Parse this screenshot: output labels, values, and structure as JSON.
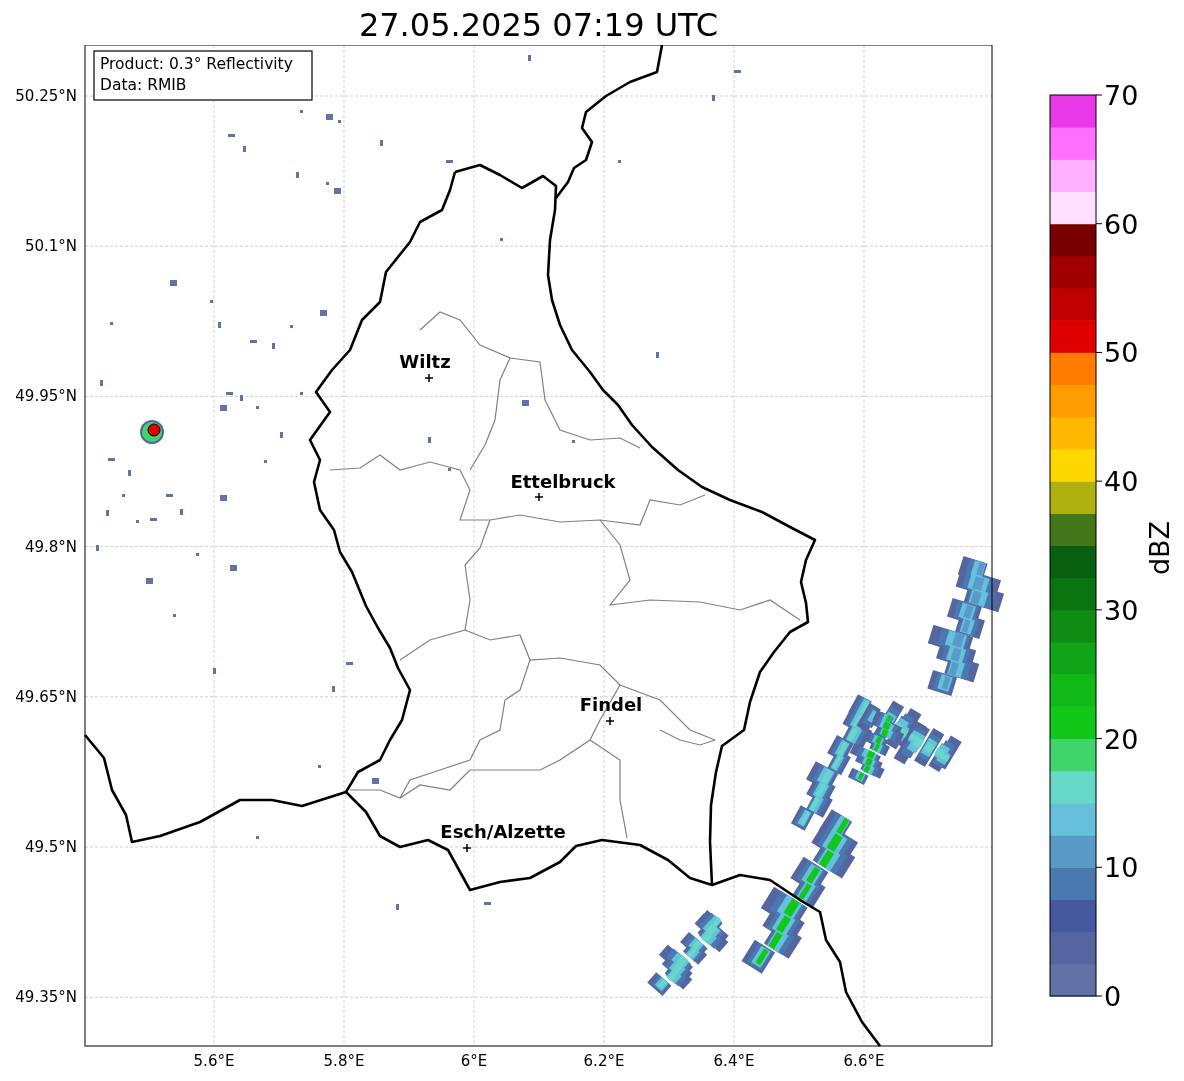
{
  "title": "27.05.2025 07:19 UTC",
  "info_box": {
    "lines": [
      "Product: 0.3° Reflectivity",
      "Data: RMIB"
    ]
  },
  "map": {
    "lat_ticks": [
      "50.25°N",
      "50.1°N",
      "49.95°N",
      "49.8°N",
      "49.65°N",
      "49.5°N",
      "49.35°N"
    ],
    "lon_ticks": [
      "5.6°E",
      "5.8°E",
      "6°E",
      "6.2°E",
      "6.4°E",
      "6.6°E"
    ],
    "cities": [
      {
        "name": "Wiltz"
      },
      {
        "name": "Ettelbruck"
      },
      {
        "name": "Findel"
      },
      {
        "name": "Esch/Alzette"
      }
    ]
  },
  "colorbar": {
    "label": "dBZ",
    "ticks": [
      "70",
      "60",
      "50",
      "40",
      "30",
      "20",
      "10",
      "0"
    ],
    "bands": [
      {
        "color": "#6272a6"
      },
      {
        "color": "#5565a0"
      },
      {
        "color": "#44599e"
      },
      {
        "color": "#4a78b0"
      },
      {
        "color": "#5a9ac8"
      },
      {
        "color": "#66c0dc"
      },
      {
        "color": "#66d8c8"
      },
      {
        "color": "#3fd46c"
      },
      {
        "color": "#10c818"
      },
      {
        "color": "#10b818"
      },
      {
        "color": "#10a418"
      },
      {
        "color": "#108c14"
      },
      {
        "color": "#0a7410"
      },
      {
        "color": "#066010"
      },
      {
        "color": "#44761a"
      },
      {
        "color": "#b0b010"
      },
      {
        "color": "#ffd800"
      },
      {
        "color": "#ffb800"
      },
      {
        "color": "#ff9c00"
      },
      {
        "color": "#ff7c00"
      },
      {
        "color": "#e00000"
      },
      {
        "color": "#c00000"
      },
      {
        "color": "#a00000"
      },
      {
        "color": "#780000"
      },
      {
        "color": "#ffe0ff"
      },
      {
        "color": "#ffb0ff"
      },
      {
        "color": "#ff70ff"
      },
      {
        "color": "#e838e8"
      }
    ]
  }
}
